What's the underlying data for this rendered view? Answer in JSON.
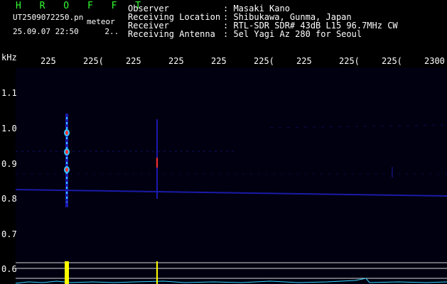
{
  "header": {
    "title": "H R O F F T",
    "file_name": "UT2509072250.pn",
    "event_label": "meteor",
    "date_time": "25.09.07 22:50",
    "extra_value": "2..",
    "info": [
      {
        "label": "Observer",
        "value": ": Masaki Kano"
      },
      {
        "label": "Receiving Location",
        "value": ": Shibukawa, Gunma, Japan"
      },
      {
        "label": "Receiver",
        "value": ": RTL-SDR SDR# 43dB L15 96.7MHz CW"
      },
      {
        "label": "Receiving Antenna",
        "value": ": 5el Yagi Az 280 for Seoul"
      }
    ]
  },
  "axes": {
    "y_unit": "kHz",
    "y_ticks": [
      "1.1",
      "1.0",
      "0.9",
      "0.8",
      "0.7",
      "0.6"
    ],
    "x_ticks": [
      "225",
      "225(",
      "225",
      "225",
      "225",
      "225(",
      "225",
      "225(",
      "225(",
      "2300"
    ]
  },
  "colors": {
    "header_title": "#33ff33",
    "header_text": "#ffffff",
    "waterfall_background": "#000010",
    "noise_band": "#1a1aa8",
    "meteor_echo_core": "#ff3030",
    "meteor_echo_halo": "#33c8ff",
    "spectrum_line": "#33d6ff",
    "spectrum_peak": "#ffff00",
    "grid_line": "#d8d8d8"
  }
}
